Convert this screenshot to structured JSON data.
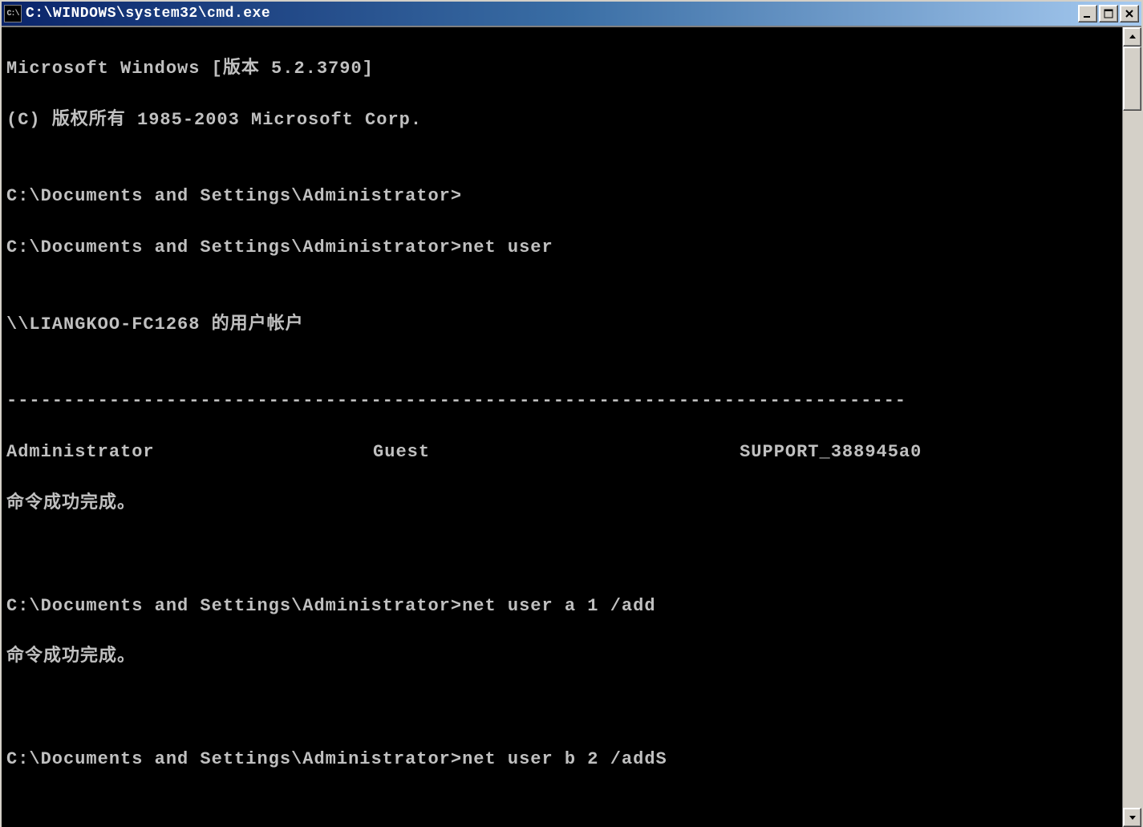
{
  "titlebar": {
    "icon_text": "C:\\",
    "title": "C:\\WINDOWS\\system32\\cmd.exe"
  },
  "terminal": {
    "lines": {
      "l0": "Microsoft Windows [版本 5.2.3790]",
      "l1": "(C) 版权所有 1985-2003 Microsoft Corp.",
      "l2": "",
      "l3": "C:\\Documents and Settings\\Administrator>",
      "l4": "C:\\Documents and Settings\\Administrator>net user",
      "l5": "",
      "l6": "\\\\LIANGKOO-FC1268 的用户帐户",
      "l7": "",
      "l8": "-------------------------------------------------------------------------------",
      "users": {
        "u0": "Administrator",
        "u1": "Guest",
        "u2": "SUPPORT_388945a0"
      },
      "l9": "命令成功完成。",
      "l10": "",
      "l11": "",
      "l12": "C:\\Documents and Settings\\Administrator>net user a 1 /add",
      "l13": "命令成功完成。",
      "l14": "",
      "l15": "",
      "l16": "C:\\Documents and Settings\\Administrator>net user b 2 /addS"
    }
  }
}
